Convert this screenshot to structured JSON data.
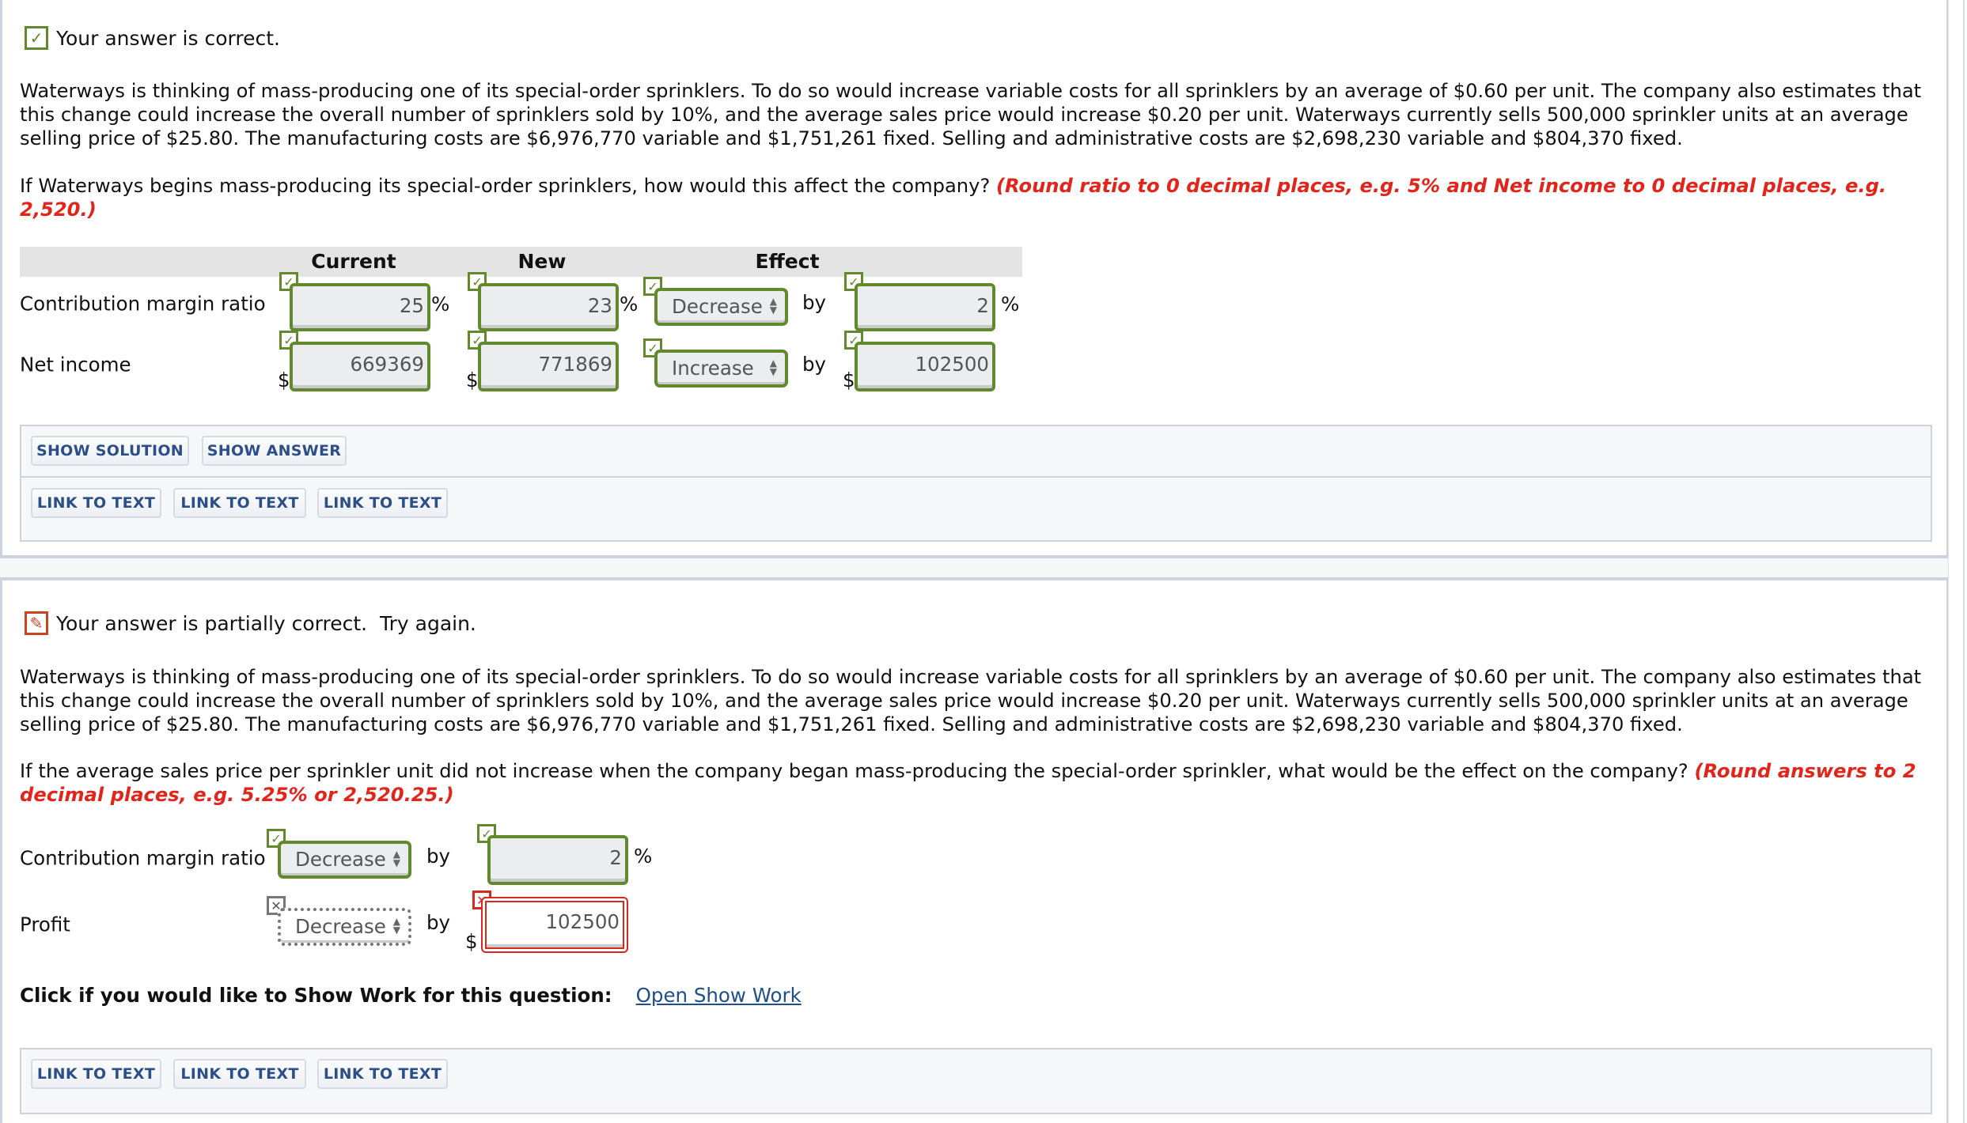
{
  "colors": {
    "correct": "#628a2c",
    "incorrect": "#d7291b",
    "button_text": "#2b4f86"
  },
  "q1": {
    "status": "Your answer is correct.",
    "status_icon": "check-icon",
    "problem": "Waterways is thinking of mass-producing one of its special-order sprinklers. To do so would increase variable costs for all sprinklers by an average of $0.60 per unit. The company also estimates that this change could increase the overall number of sprinklers sold by 10%, and the average sales price would increase $0.20 per unit. Waterways currently sells 500,000 sprinkler units at an average selling price of $25.80. The manufacturing costs are $6,976,770 variable and $1,751,261 fixed. Selling and administrative costs are $2,698,230 variable and $804,370 fixed.",
    "question": "If Waterways begins mass-producing its special-order sprinklers, how would this affect the company?",
    "hint": "(Round ratio to 0 decimal places, e.g. 5% and Net income to 0 decimal places, e.g. 2,520.)",
    "headers": {
      "current": "Current",
      "new": "New",
      "effect": "Effect"
    },
    "rows": [
      {
        "label": "Contribution margin ratio",
        "current": "25",
        "new": "23",
        "effect": "Decrease",
        "by": "by",
        "amount": "2",
        "unit": "%",
        "prefix": ""
      },
      {
        "label": "Net income",
        "current": "669369",
        "new": "771869",
        "effect": "Increase",
        "by": "by",
        "amount": "102500",
        "unit": "",
        "prefix": "$"
      }
    ],
    "pct": "%",
    "buttons": {
      "show_solution": "SHOW SOLUTION",
      "show_answer": "SHOW ANSWER",
      "links": [
        "LINK TO TEXT",
        "LINK TO TEXT",
        "LINK TO TEXT"
      ]
    }
  },
  "q2": {
    "status": "Your answer is partially correct.  Try again.",
    "status_icon": "pencil-icon",
    "problem": "Waterways is thinking of mass-producing one of its special-order sprinklers. To do so would increase variable costs for all sprinklers by an average of $0.60 per unit. The company also estimates that this change could increase the overall number of sprinklers sold by 10%, and the average sales price would increase $0.20 per unit. Waterways currently sells 500,000 sprinkler units at an average selling price of $25.80. The manufacturing costs are $6,976,770 variable and $1,751,261 fixed. Selling and administrative costs are $2,698,230 variable and $804,370 fixed.",
    "question": "If the average sales price per sprinkler unit did not increase when the company began mass-producing the special-order sprinkler, what would be the effect on the company?",
    "hint": "(Round answers to 2 decimal places, e.g. 5.25% or 2,520.25.)",
    "rows": [
      {
        "label": "Contribution margin ratio",
        "effect": "Decrease",
        "by": "by",
        "amount": "2",
        "unit": "%"
      },
      {
        "label": "Profit",
        "effect": "Decrease",
        "by": "by",
        "amount": "102500",
        "prefix": "$"
      }
    ],
    "show_work_prompt": "Click if you would like to Show Work for this question:",
    "show_work_link": "Open Show Work",
    "buttons": {
      "links": [
        "LINK TO TEXT",
        "LINK TO TEXT",
        "LINK TO TEXT"
      ]
    }
  }
}
